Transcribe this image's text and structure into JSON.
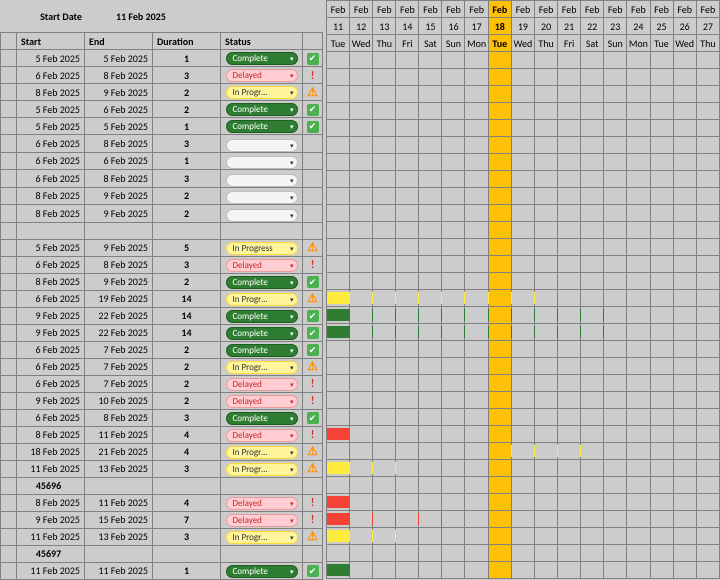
{
  "header": {
    "label": "Start Date",
    "value": "11 Feb 2025"
  },
  "columns": {
    "start": "Start",
    "end": "End",
    "duration": "Duration",
    "status": "Status"
  },
  "status_labels": {
    "complete": "Complete",
    "delayed": "Delayed",
    "in_progress": "In Progr…",
    "in_progress_full": "In Progress",
    "empty": ""
  },
  "icons": {
    "check": "✔",
    "warn": "⚠",
    "excl": "!",
    "dropdown": "▾"
  },
  "timeline": {
    "month_short": "Feb",
    "days": [
      11,
      12,
      13,
      14,
      15,
      16,
      17,
      18,
      19,
      20,
      21,
      22,
      23,
      24,
      25,
      26,
      27
    ],
    "dow": [
      "Tue",
      "Wed",
      "Thu",
      "Fri",
      "Sat",
      "Sun",
      "Mon",
      "Tue",
      "Wed",
      "Thu",
      "Fri",
      "Sat",
      "Sun",
      "Mon",
      "Tue",
      "Wed",
      "Thu"
    ],
    "today_index": 7
  },
  "colors": {
    "complete": "#2e7d32",
    "delayed": "#f44336",
    "in_progress": "#ffeb3b",
    "today": "#ffc107"
  },
  "tasks": [
    {
      "start": "5 Feb 2025",
      "end": "5 Feb 2025",
      "dur": "1",
      "status": "complete",
      "flag": "check",
      "bar": null
    },
    {
      "start": "6 Feb 2025",
      "end": "8 Feb 2025",
      "dur": "3",
      "status": "delayed",
      "flag": "excl",
      "bar": null
    },
    {
      "start": "8 Feb 2025",
      "end": "9 Feb 2025",
      "dur": "2",
      "status": "in_progress",
      "flag": "warn",
      "bar": null
    },
    {
      "start": "5 Feb 2025",
      "end": "6 Feb 2025",
      "dur": "2",
      "status": "complete",
      "flag": "check",
      "bar": null
    },
    {
      "start": "5 Feb 2025",
      "end": "5 Feb 2025",
      "dur": "1",
      "status": "complete",
      "flag": "check",
      "bar": null
    },
    {
      "start": "6 Feb 2025",
      "end": "8 Feb 2025",
      "dur": "3",
      "status": "empty",
      "flag": "",
      "bar": null
    },
    {
      "start": "6 Feb 2025",
      "end": "6 Feb 2025",
      "dur": "1",
      "status": "empty",
      "flag": "",
      "bar": null
    },
    {
      "start": "6 Feb 2025",
      "end": "8 Feb 2025",
      "dur": "3",
      "status": "empty",
      "flag": "",
      "bar": null
    },
    {
      "start": "8 Feb 2025",
      "end": "9 Feb 2025",
      "dur": "2",
      "status": "empty",
      "flag": "",
      "bar": null
    },
    {
      "start": "8 Feb 2025",
      "end": "9 Feb 2025",
      "dur": "2",
      "status": "empty",
      "flag": "",
      "bar": null
    },
    {
      "start": "",
      "end": "",
      "dur": "",
      "status": "none",
      "flag": "",
      "bar": null
    },
    {
      "start": "5 Feb 2025",
      "end": "9 Feb 2025",
      "dur": "5",
      "status": "in_progress_full",
      "flag": "warn",
      "bar": null
    },
    {
      "start": "6 Feb 2025",
      "end": "8 Feb 2025",
      "dur": "3",
      "status": "delayed",
      "flag": "excl",
      "bar": null
    },
    {
      "start": "8 Feb 2025",
      "end": "9 Feb 2025",
      "dur": "2",
      "status": "complete",
      "flag": "check",
      "bar": null
    },
    {
      "start": "6 Feb 2025",
      "end": "19 Feb 2025",
      "dur": "14",
      "status": "in_progress",
      "flag": "warn",
      "bar": {
        "from": 0,
        "to": 8.8,
        "color": "in_progress"
      }
    },
    {
      "start": "9 Feb 2025",
      "end": "22 Feb 2025",
      "dur": "14",
      "status": "complete",
      "flag": "check",
      "bar": {
        "from": 0,
        "to": 11.8,
        "color": "complete"
      }
    },
    {
      "start": "9 Feb 2025",
      "end": "22 Feb 2025",
      "dur": "14",
      "status": "complete",
      "flag": "check",
      "bar": {
        "from": 0,
        "to": 11.8,
        "color": "complete"
      }
    },
    {
      "start": "6 Feb 2025",
      "end": "7 Feb 2025",
      "dur": "2",
      "status": "complete",
      "flag": "check",
      "bar": null
    },
    {
      "start": "6 Feb 2025",
      "end": "7 Feb 2025",
      "dur": "2",
      "status": "in_progress",
      "flag": "warn",
      "bar": null
    },
    {
      "start": "6 Feb 2025",
      "end": "7 Feb 2025",
      "dur": "2",
      "status": "delayed",
      "flag": "excl",
      "bar": null
    },
    {
      "start": "9 Feb 2025",
      "end": "10 Feb 2025",
      "dur": "2",
      "status": "delayed",
      "flag": "excl",
      "bar": null
    },
    {
      "start": "6 Feb 2025",
      "end": "8 Feb 2025",
      "dur": "3",
      "status": "complete",
      "flag": "check",
      "bar": null
    },
    {
      "start": "8 Feb 2025",
      "end": "11 Feb 2025",
      "dur": "4",
      "status": "delayed",
      "flag": "excl",
      "bar": {
        "from": 0,
        "to": 0.8,
        "color": "delayed"
      }
    },
    {
      "start": "18 Feb 2025",
      "end": "21 Feb 2025",
      "dur": "4",
      "status": "in_progress",
      "flag": "warn",
      "bar": {
        "from": 7,
        "to": 10.8,
        "color": "in_progress"
      }
    },
    {
      "start": "11 Feb 2025",
      "end": "13 Feb 2025",
      "dur": "3",
      "status": "in_progress",
      "flag": "warn",
      "bar": {
        "from": 0,
        "to": 2.8,
        "color": "in_progress"
      }
    },
    {
      "start": "45696",
      "end": "",
      "dur": "",
      "status": "none",
      "flag": "",
      "bar": null,
      "serialLike": true
    },
    {
      "start": "8 Feb 2025",
      "end": "11 Feb 2025",
      "dur": "4",
      "status": "delayed",
      "flag": "excl",
      "bar": {
        "from": 0,
        "to": 0.8,
        "color": "delayed"
      }
    },
    {
      "start": "9 Feb 2025",
      "end": "15 Feb 2025",
      "dur": "7",
      "status": "delayed",
      "flag": "excl",
      "bar": {
        "from": 0,
        "to": 4.8,
        "color": "delayed"
      }
    },
    {
      "start": "11 Feb 2025",
      "end": "13 Feb 2025",
      "dur": "3",
      "status": "in_progress",
      "flag": "warn",
      "bar": {
        "from": 0,
        "to": 2.8,
        "color": "in_progress"
      }
    },
    {
      "start": "45697",
      "end": "",
      "dur": "",
      "status": "none",
      "flag": "",
      "bar": null,
      "serialLike": true
    },
    {
      "start": "11 Feb 2025",
      "end": "11 Feb 2025",
      "dur": "1",
      "status": "complete",
      "flag": "check",
      "bar": {
        "from": 0,
        "to": 0.8,
        "color": "complete"
      }
    }
  ]
}
